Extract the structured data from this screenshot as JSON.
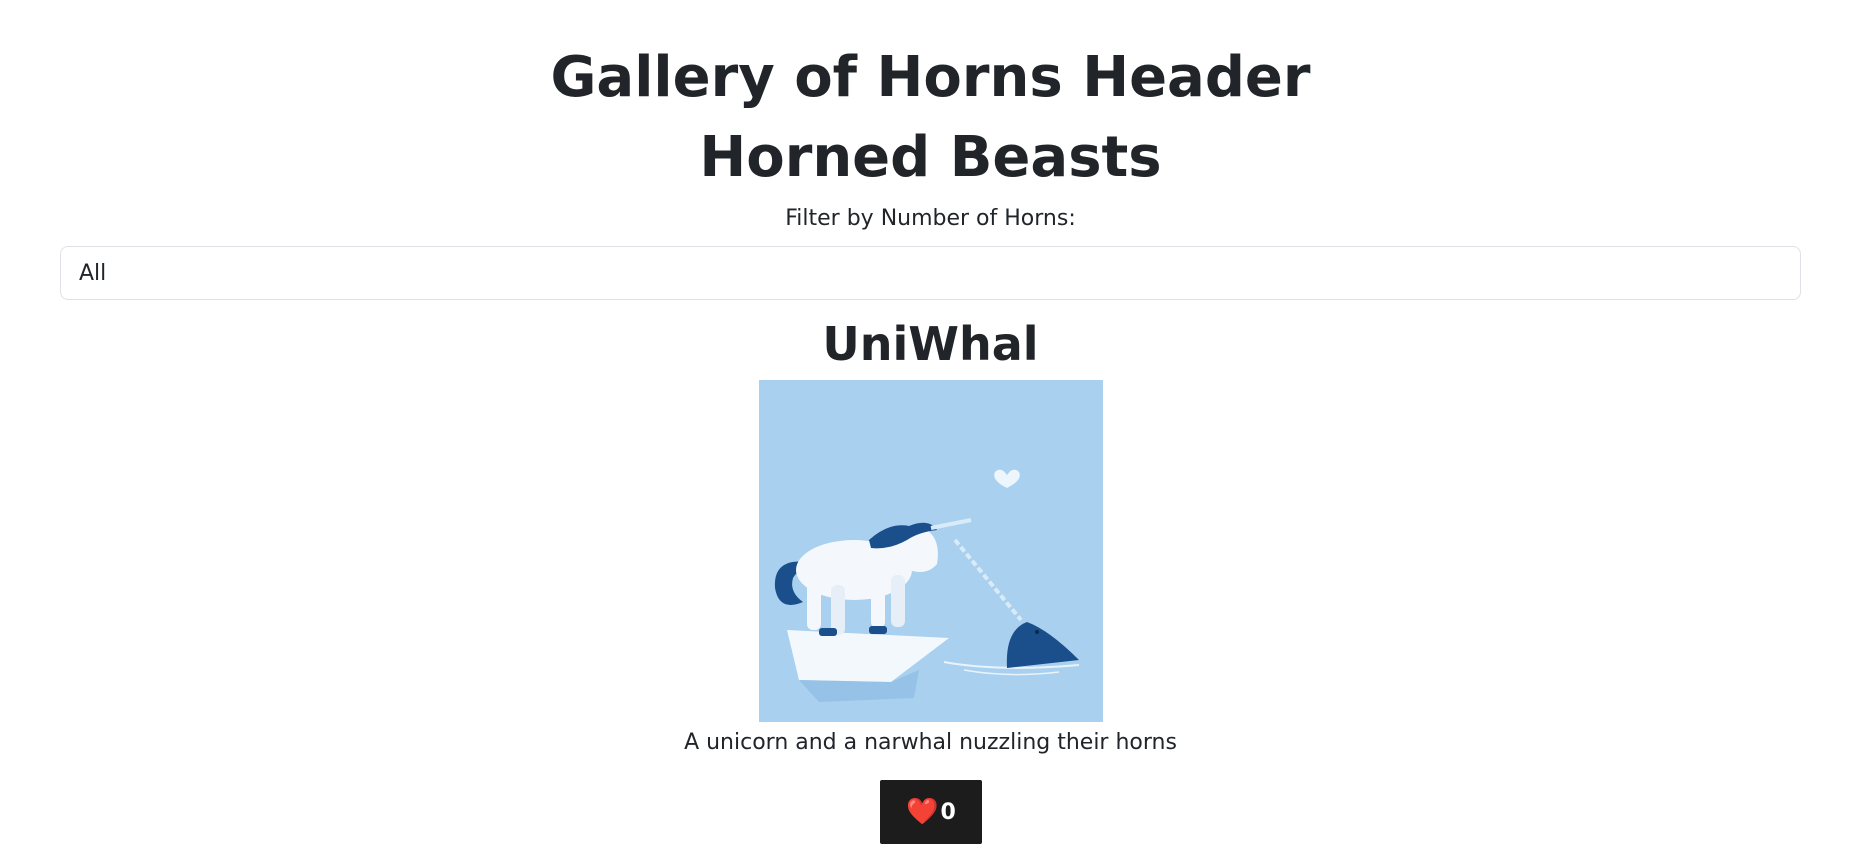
{
  "header": {
    "title": "Gallery of Horns Header"
  },
  "main": {
    "title": "Horned Beasts",
    "filter": {
      "label": "Filter by Number of Horns:",
      "selected": "All"
    },
    "beasts": [
      {
        "title": "UniWhal",
        "description": "A unicorn and a narwhal nuzzling their horns",
        "likes": "0",
        "like_icon": "heart-icon"
      }
    ]
  },
  "colors": {
    "image_background": "#a9d0ee",
    "button_background": "#1c1c1c",
    "heart": "#e21c2a"
  }
}
